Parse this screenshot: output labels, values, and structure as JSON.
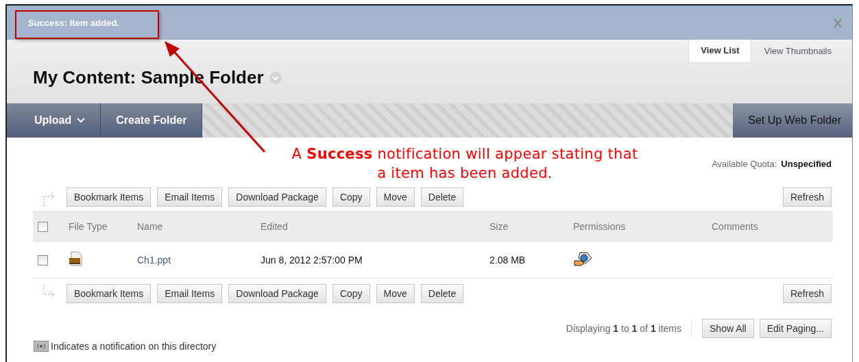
{
  "notification": {
    "message": "Success: Item added."
  },
  "view_tabs": [
    {
      "label": "View List",
      "selected": true
    },
    {
      "label": "View Thumbnails",
      "selected": false
    }
  ],
  "page_title": "My Content: Sample Folder",
  "action_bar": {
    "left": [
      {
        "label": "Upload",
        "kind": "menu"
      },
      {
        "label": "Create Folder",
        "kind": "button"
      }
    ],
    "right": [
      {
        "label": "Set Up Web Folder"
      }
    ]
  },
  "annotation": {
    "lines": [
      "A **Success** notification will appear stating that",
      "a item has been added."
    ]
  },
  "quota": {
    "label": "Available Quota:",
    "value": "Unspecified"
  },
  "toolbar_top": {
    "buttons": [
      "Bookmark Items",
      "Email Items",
      "Download Package",
      "Copy",
      "Move",
      "Delete"
    ],
    "refresh": "Refresh"
  },
  "table": {
    "select_all": {
      "checked": false
    },
    "columns": [
      "File Type",
      "Name",
      "Edited",
      "Size",
      "Permissions",
      "Comments"
    ],
    "rows": [
      {
        "selected": false,
        "kind": "ppt",
        "name": "Ch1.ppt",
        "edited": "Jun 8, 2012 2:57:00 PM",
        "size": "2.08 MB"
      }
    ]
  },
  "toolbar_bottom": {
    "buttons": [
      "Bookmark Items",
      "Email Items",
      "Download Package",
      "Copy",
      "Move",
      "Delete"
    ],
    "refresh": "Refresh"
  },
  "paging": {
    "text": "Displaying **1** to **1** of **1** items",
    "buttons": [
      "Show All",
      "Edit Paging..."
    ]
  },
  "legend": "Indicates a notification on this directory"
}
